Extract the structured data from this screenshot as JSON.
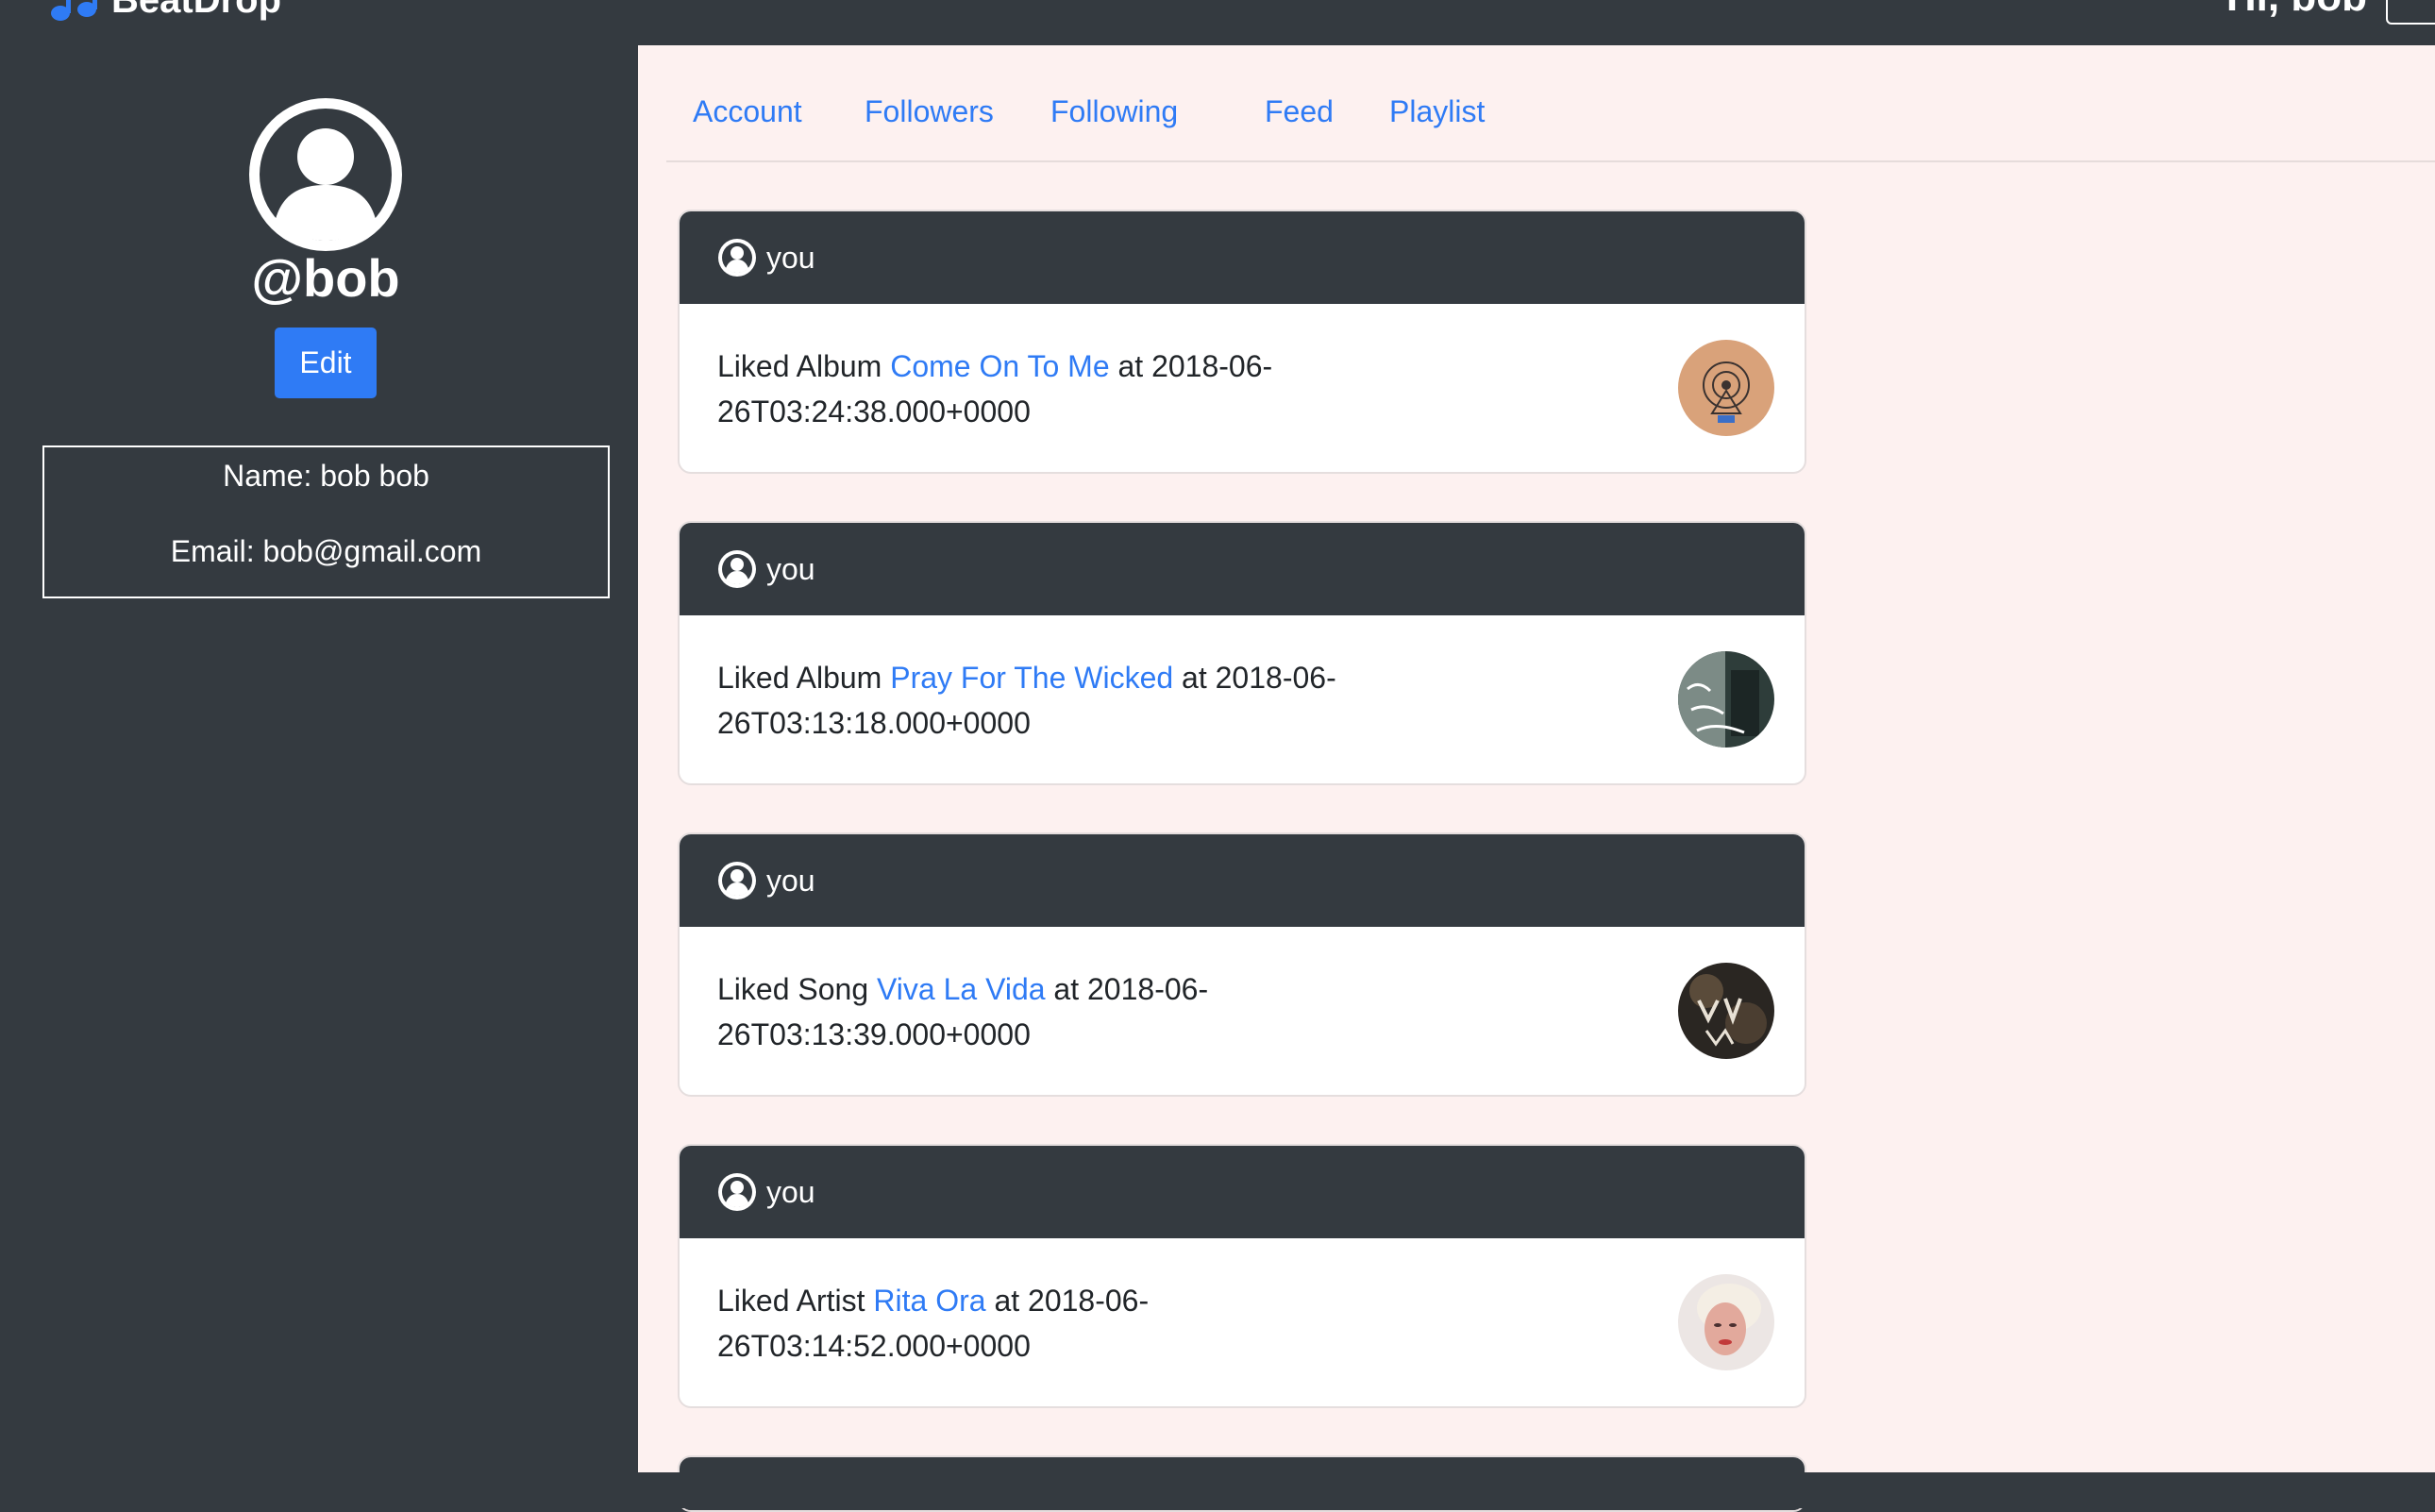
{
  "navbar": {
    "brand": "BeatDrop",
    "greeting": "Hi, bob"
  },
  "profile": {
    "handle": "@bob",
    "edit_label": "Edit",
    "name_line": "Name: bob bob",
    "email_line": "Email: bob@gmail.com"
  },
  "tabs": [
    {
      "label": "Account"
    },
    {
      "label": "Followers"
    },
    {
      "label": "Following"
    },
    {
      "label": "Feed"
    },
    {
      "label": "Playlist"
    }
  ],
  "feed": [
    {
      "user": "you",
      "action": "Liked Album",
      "item": "Come On To Me",
      "suffix": "at 2018-06-26T03:24:38.000+0000",
      "thumb_color": "#d9a27a"
    },
    {
      "user": "you",
      "action": "Liked Album",
      "item": "Pray For The Wicked",
      "suffix": "at 2018-06-26T03:13:18.000+0000",
      "thumb_color": "#2e3d3a"
    },
    {
      "user": "you",
      "action": "Liked Song",
      "item": "Viva La Vida",
      "suffix": "at 2018-06-26T03:13:39.000+0000",
      "thumb_color": "#2a2622"
    },
    {
      "user": "you",
      "action": "Liked Artist",
      "item": "Rita Ora",
      "suffix": "at 2018-06-26T03:14:52.000+0000",
      "thumb_color": "#d8b5ad"
    }
  ],
  "colors": {
    "accent": "#2f7bf5",
    "dark": "#343a40",
    "main_bg": "#fdf1f0"
  }
}
